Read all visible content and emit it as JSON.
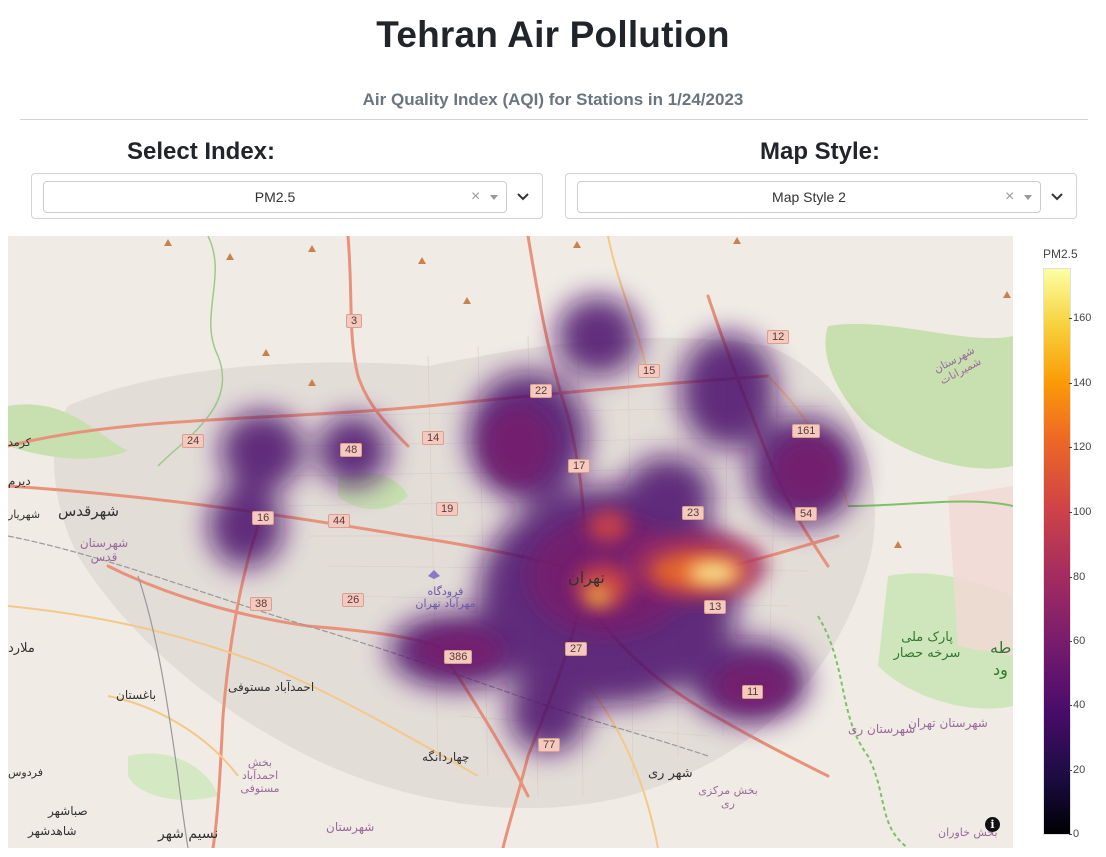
{
  "header": {
    "title": "Tehran Air Pollution",
    "subtitle": "Air Quality Index (AQI) for Stations in 1/24/2023"
  },
  "controls": {
    "index_label": "Select Index:",
    "index_value": "PM2.5",
    "style_label": "Map Style:",
    "style_value": "Map Style 2",
    "clear_glyph": "×"
  },
  "map": {
    "city_label": "تهران",
    "place_labels": [
      {
        "text": "شهرقدس"
      },
      {
        "text": "شهرستان قدس"
      },
      {
        "text": "فرودگاه مهرآباد تهران"
      },
      {
        "text": "احمدآباد مستوفی"
      },
      {
        "text": "باغستان"
      },
      {
        "text": "بخش احمدآباد مستوفی"
      },
      {
        "text": "چهاردانگه"
      },
      {
        "text": "شهر ری"
      },
      {
        "text": "بخش مرکزی ری"
      },
      {
        "text": "صباشهر"
      },
      {
        "text": "شاهدشهر"
      },
      {
        "text": "شهرستان تهران"
      },
      {
        "text": "شهرستان ری"
      },
      {
        "text": "پارک ملی سرخه حصار"
      },
      {
        "text": "شهرستان شمیرانات"
      },
      {
        "text": "بخش خاوران"
      },
      {
        "text": "کرمد"
      },
      {
        "text": "ملارد"
      },
      {
        "text": "شهریار"
      },
      {
        "text": "نسیم شهر"
      },
      {
        "text": "فردوس"
      },
      {
        "text": "شهرستان"
      },
      {
        "text": "طه"
      },
      {
        "text": "ود"
      },
      {
        "text": "دیرم"
      }
    ],
    "road_shields": [
      "3",
      "22",
      "15",
      "12",
      "24",
      "48",
      "14",
      "17",
      "161",
      "16",
      "44",
      "19",
      "23",
      "54",
      "38",
      "26",
      "13",
      "386",
      "27",
      "11",
      "77"
    ],
    "info_glyph": "i"
  },
  "colorbar": {
    "title": "PM2.5",
    "ticks": [
      "160",
      "140",
      "120",
      "100",
      "80",
      "60",
      "40",
      "20",
      "0"
    ]
  },
  "colors": {
    "heat_low": "#4a0c6b",
    "heat_mid": "#cf4446",
    "heat_high": "#fcffa4",
    "road_major": "#e8927c",
    "park_green": "#b9dca3"
  }
}
